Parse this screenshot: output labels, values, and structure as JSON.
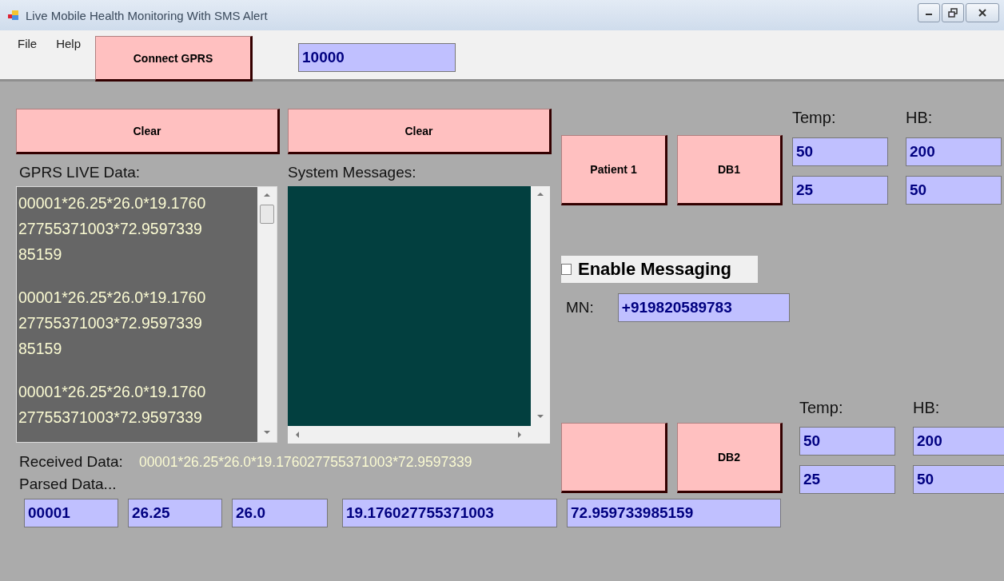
{
  "window": {
    "title": "Live Mobile Health Monitoring With SMS Alert"
  },
  "menu": [
    {
      "label": "File"
    },
    {
      "label": "Help"
    }
  ],
  "toolbar": {
    "connect_button": "Connect GPRS",
    "interval_field": "10000"
  },
  "live_data": {
    "clear_button": "Clear",
    "label": "GPRS LIVE Data:",
    "entries": [
      [
        "00001*26.25*26.0*19.1760",
        "27755371003*72.9597339",
        "85159"
      ],
      [
        "00001*26.25*26.0*19.1760",
        "27755371003*72.9597339",
        "85159"
      ],
      [
        "00001*26.25*26.0*19.1760",
        "27755371003*72.9597339"
      ]
    ]
  },
  "system_messages": {
    "clear_button": "Clear",
    "label": "System Messages:"
  },
  "received": {
    "label": "Received Data:",
    "value": "00001*26.25*26.0*19.176027755371003*72.9597339"
  },
  "parsed": {
    "label": "Parsed Data...",
    "fields": [
      "00001",
      "26.25",
      "26.0",
      "19.176027755371003",
      "72.959733985159"
    ]
  },
  "patients": [
    {
      "patient_button": "Patient 1",
      "db_button": "DB1",
      "temp_label": "Temp:",
      "hb_label": "HB:",
      "temp_high": "50",
      "temp_low": "25",
      "hb_high": "200",
      "hb_low": "50"
    },
    {
      "db_button": "DB2",
      "temp_label": "Temp:",
      "hb_label": "HB:",
      "temp_high": "50",
      "temp_low": "25",
      "hb_high": "200",
      "hb_low": "50"
    }
  ],
  "messaging": {
    "label": "Enable Messaging",
    "checked": false
  },
  "mobile": {
    "label": "MN:",
    "value": "+919820589783"
  }
}
